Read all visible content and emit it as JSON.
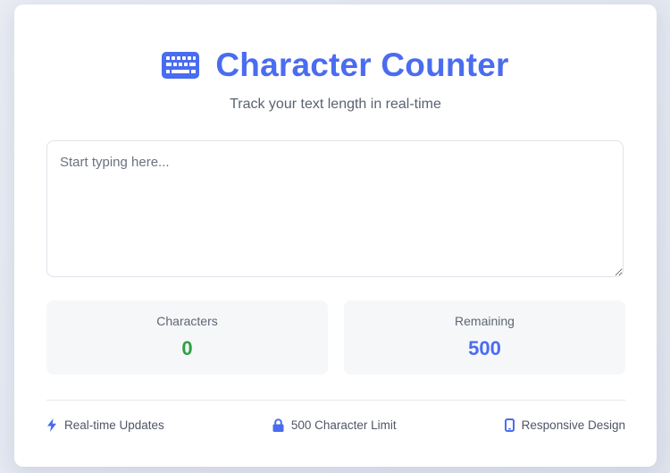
{
  "header": {
    "title": "Character Counter",
    "subtitle": "Track your text length in real-time",
    "icon": "keyboard-icon"
  },
  "editor": {
    "placeholder": "Start typing here...",
    "value": ""
  },
  "stats": {
    "characters_label": "Characters",
    "characters_value": "0",
    "remaining_label": "Remaining",
    "remaining_value": "500"
  },
  "features": [
    {
      "label": "Real-time Updates",
      "icon": "bolt-icon"
    },
    {
      "label": "500 Character Limit",
      "icon": "lock-icon"
    },
    {
      "label": "Responsive Design",
      "icon": "mobile-icon"
    }
  ],
  "colors": {
    "accent": "#4a6cf0",
    "characters_value": "#2ea043",
    "remaining_value": "#4a6cf0"
  }
}
